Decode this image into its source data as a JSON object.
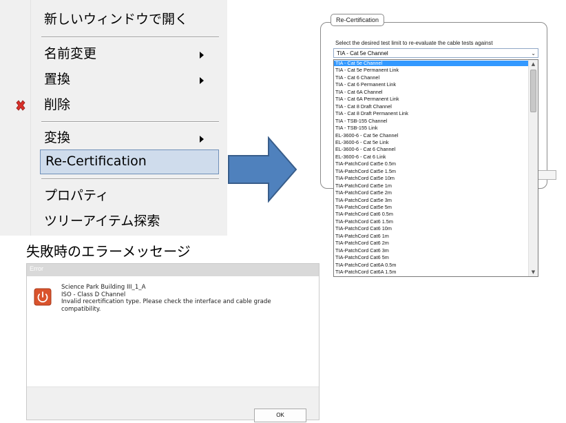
{
  "context_menu": {
    "items": [
      {
        "label": "新しいウィンドウで開く"
      },
      {
        "label": "名前変更",
        "submenu": true
      },
      {
        "label": "置換",
        "submenu": true
      },
      {
        "label": "削除",
        "icon": "delete-x-icon"
      },
      {
        "label": "変換",
        "submenu": true
      },
      {
        "label": "Re-Certification",
        "highlighted": true
      },
      {
        "label": "プロパティ"
      },
      {
        "label": "ツリーアイテム探索"
      }
    ]
  },
  "recert_dialog": {
    "group_title": "Re-Certification",
    "prompt": "Select the desired test limit to re-evaluate the cable tests against",
    "selected_value": "TIA - Cat 5e Channel",
    "options": [
      "TIA - Cat 5e Channel",
      "TIA - Cat 5e Permanent Link",
      "TIA - Cat 6 Channel",
      "TIA - Cat 6 Permanent Link",
      "TIA - Cat 6A Channel",
      "TIA - Cat 6A Permanent Link",
      "TIA - Cat 8 Draft Channel",
      "TIA - Cat 8 Draft Permanent Link",
      "TIA - TSB-155 Channel",
      "TIA - TSB-155 Link",
      "EL-3600-6 - Cat 5e Channel",
      "EL-3600-6 - Cat 5e Link",
      "EL-3600-6 - Cat 6 Channel",
      "EL-3600-6 - Cat 6 Link",
      "TIA-PatchCord Cat5e 0.5m",
      "TIA-PatchCord Cat5e 1.5m",
      "TIA-PatchCord Cat5e 10m",
      "TIA-PatchCord Cat5e 1m",
      "TIA-PatchCord Cat5e 2m",
      "TIA-PatchCord Cat5e 3m",
      "TIA-PatchCord Cat5e 5m",
      "TIA-PatchCord Cat6 0.5m",
      "TIA-PatchCord Cat6 1.5m",
      "TIA-PatchCord Cat6 10m",
      "TIA-PatchCord Cat6 1m",
      "TIA-PatchCord Cat6 2m",
      "TIA-PatchCord Cat6 3m",
      "TIA-PatchCord Cat6 5m",
      "TIA-PatchCord Cat6A 0.5m",
      "TIA-PatchCord Cat6A 1.5m"
    ]
  },
  "error_section": {
    "caption": "失敗時のエラーメッセージ",
    "window_title": "Error",
    "message_lines": [
      "Science Park Building III_1_A",
      "ISO - Class D Channel",
      "Invalid recertification type. Please check the interface and cable grade",
      "compatibility."
    ],
    "ok_label": "OK"
  },
  "colors": {
    "arrow_fill": "#4f81bd",
    "arrow_stroke": "#385d8a",
    "selection": "#3399ff",
    "menu_highlight": "#cfdcec",
    "error_icon": "#d9532c"
  }
}
